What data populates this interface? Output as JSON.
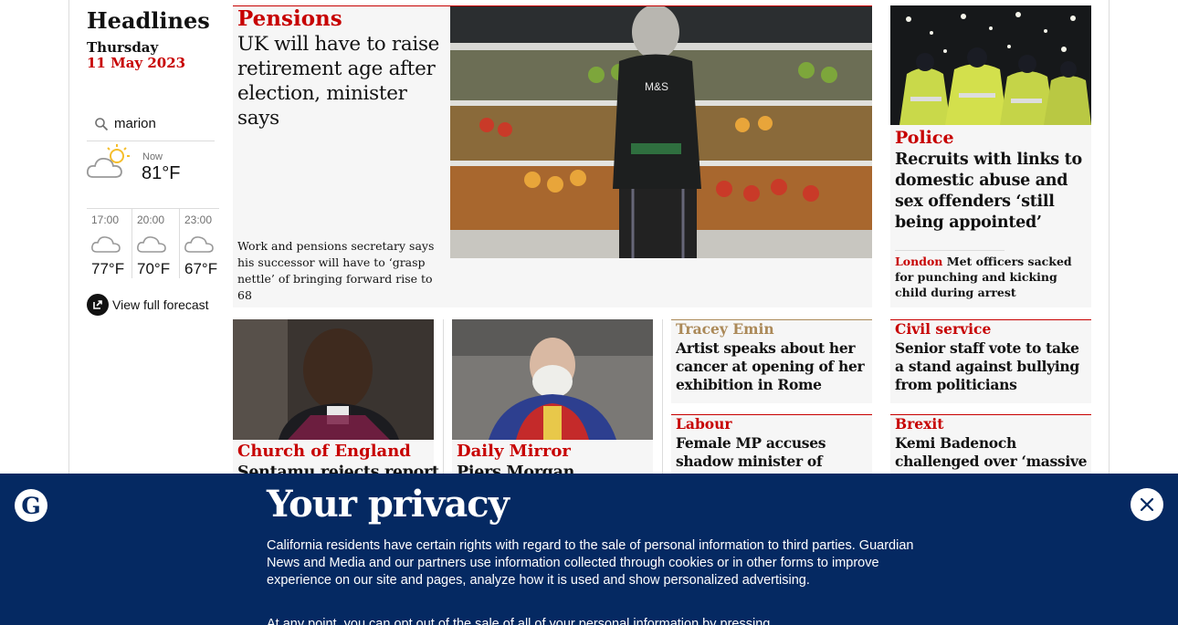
{
  "sidebar": {
    "heading": "Headlines",
    "day": "Thursday",
    "date": "11 May 2023",
    "location_value": "marion",
    "now_label": "Now",
    "now_temp": "81°F",
    "forecast": [
      {
        "time": "17:00",
        "temp": "77°F",
        "icon": "cloud-icon"
      },
      {
        "time": "20:00",
        "temp": "70°F",
        "icon": "cloud-icon"
      },
      {
        "time": "23:00",
        "temp": "67°F",
        "icon": "cloud-icon"
      }
    ],
    "full_forecast_label": "View full forecast"
  },
  "main_story": {
    "kicker": "Pensions",
    "headline": "UK will have to raise retirement age after election, minister says",
    "standfirst": "Work and pensions secretary says his successor will have to ‘grasp nettle’ of bringing forward rise to 68",
    "image_text": "M&S"
  },
  "police_story": {
    "kicker": "Police",
    "headline": "Recruits with links to domestic abuse and sex offenders ‘still being appointed’",
    "sub_kicker": "London",
    "sub_headline": "Met officers sacked for punching and kicking child during arrest"
  },
  "row2": [
    {
      "kicker": "Church of England",
      "headline": "Sentamu rejects report"
    },
    {
      "kicker": "Daily Mirror",
      "headline": "Piers Morgan"
    },
    {
      "kicker": "Tracey Emin",
      "headline": "Artist speaks about her cancer at opening of her exhibition in Rome"
    },
    {
      "kicker": "Civil service",
      "headline": "Senior staff vote to take a stand against bullying from politicians"
    },
    {
      "kicker": "Labour",
      "headline": "Female MP accuses shadow minister of sexual"
    },
    {
      "kicker": "Brexit",
      "headline": "Kemi Badenoch challenged over ‘massive"
    }
  ],
  "privacy": {
    "title": "Your privacy",
    "body": "California residents have certain rights with regard to the sale of personal information to third parties. Guardian News and Media and our partners use information collected through cookies or in other forms to improve experience on our site and pages, analyze how it is used and show personalized advertising.",
    "body2": "At any point, you can opt out of the sale of all of your personal information by pressing",
    "logo": "G"
  },
  "colors": {
    "news_red": "#c70000",
    "culture_gold": "#ab8958",
    "brand_blue": "#052962"
  }
}
